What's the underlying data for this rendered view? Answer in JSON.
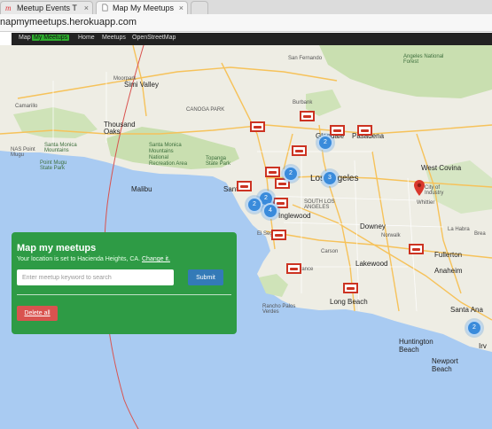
{
  "browser": {
    "tabs": [
      {
        "label": "Meetup Events Timel"
      },
      {
        "label": "Map My Meetups"
      }
    ],
    "url": "napmymeetups.herokuapp.com"
  },
  "navbar": {
    "items": [
      "Map",
      "My Meetups",
      "Home",
      "Meetups",
      "OpenStreetMap"
    ]
  },
  "map": {
    "labels": {
      "simi_valley": "Simi Valley",
      "moorpark": "Moorpark",
      "camarillo": "Camarillo",
      "thousand_oaks": "Thousand Oaks",
      "nas_point_mugu": "NAS Point Mugu",
      "smm": "Santa Monica Mountains",
      "smm_nra": "Santa Monica Mountains National Recreation Area",
      "topanga": "Topanga State Park",
      "malibu": "Malibu",
      "pasadena": "Pasadena",
      "glendale": "Glendale",
      "los_angeles": "Los Angeles",
      "inglewood": "Inglewood",
      "downey": "Downey",
      "lakewood": "Lakewood",
      "long_beach": "Long Beach",
      "west_covina": "West Covina",
      "city_of_industry": "City of Industry",
      "fullerton": "Fullerton",
      "anaheim": "Anaheim",
      "santa_ana": "Santa Ana",
      "huntington_beach": "Huntington Beach",
      "newport_beach": "Newport Beach",
      "irvine": "Irv",
      "san_fernando": "San Fernando",
      "angeles_nf": "Angeles National Forest",
      "canoga_park": "CANOGA PARK",
      "burbank": "Burbank",
      "santa_monica": "Santa",
      "el_segundo": "El Segundo",
      "rancho_palos_verdes": "Rancho Palos Verdes",
      "south_la": "SOUTH LOS ANGELES",
      "point_mugu_sp": "Point Mugu State Park",
      "torrance": "Torrance",
      "carson": "Carson",
      "norwalk": "Norwalk",
      "whittier": "Whittier",
      "la_habra": "La Habra",
      "brea": "Brea"
    },
    "clusters": [
      "2",
      "2",
      "3",
      "2",
      "2",
      "4",
      "2"
    ],
    "colors": {
      "water": "#a9cbf2",
      "land": "#eeede4",
      "park": "#c9dfb0",
      "road": "#f6c25a",
      "circle": "#d9534f"
    }
  },
  "panel": {
    "title": "Map my meetups",
    "location_text": "Your location is set to Hacienda Heights, CA.",
    "change_link": "Change it.",
    "search_placeholder": "Enter meetup keyword to search",
    "submit_label": "Submit",
    "delete_label": "Delete all"
  }
}
